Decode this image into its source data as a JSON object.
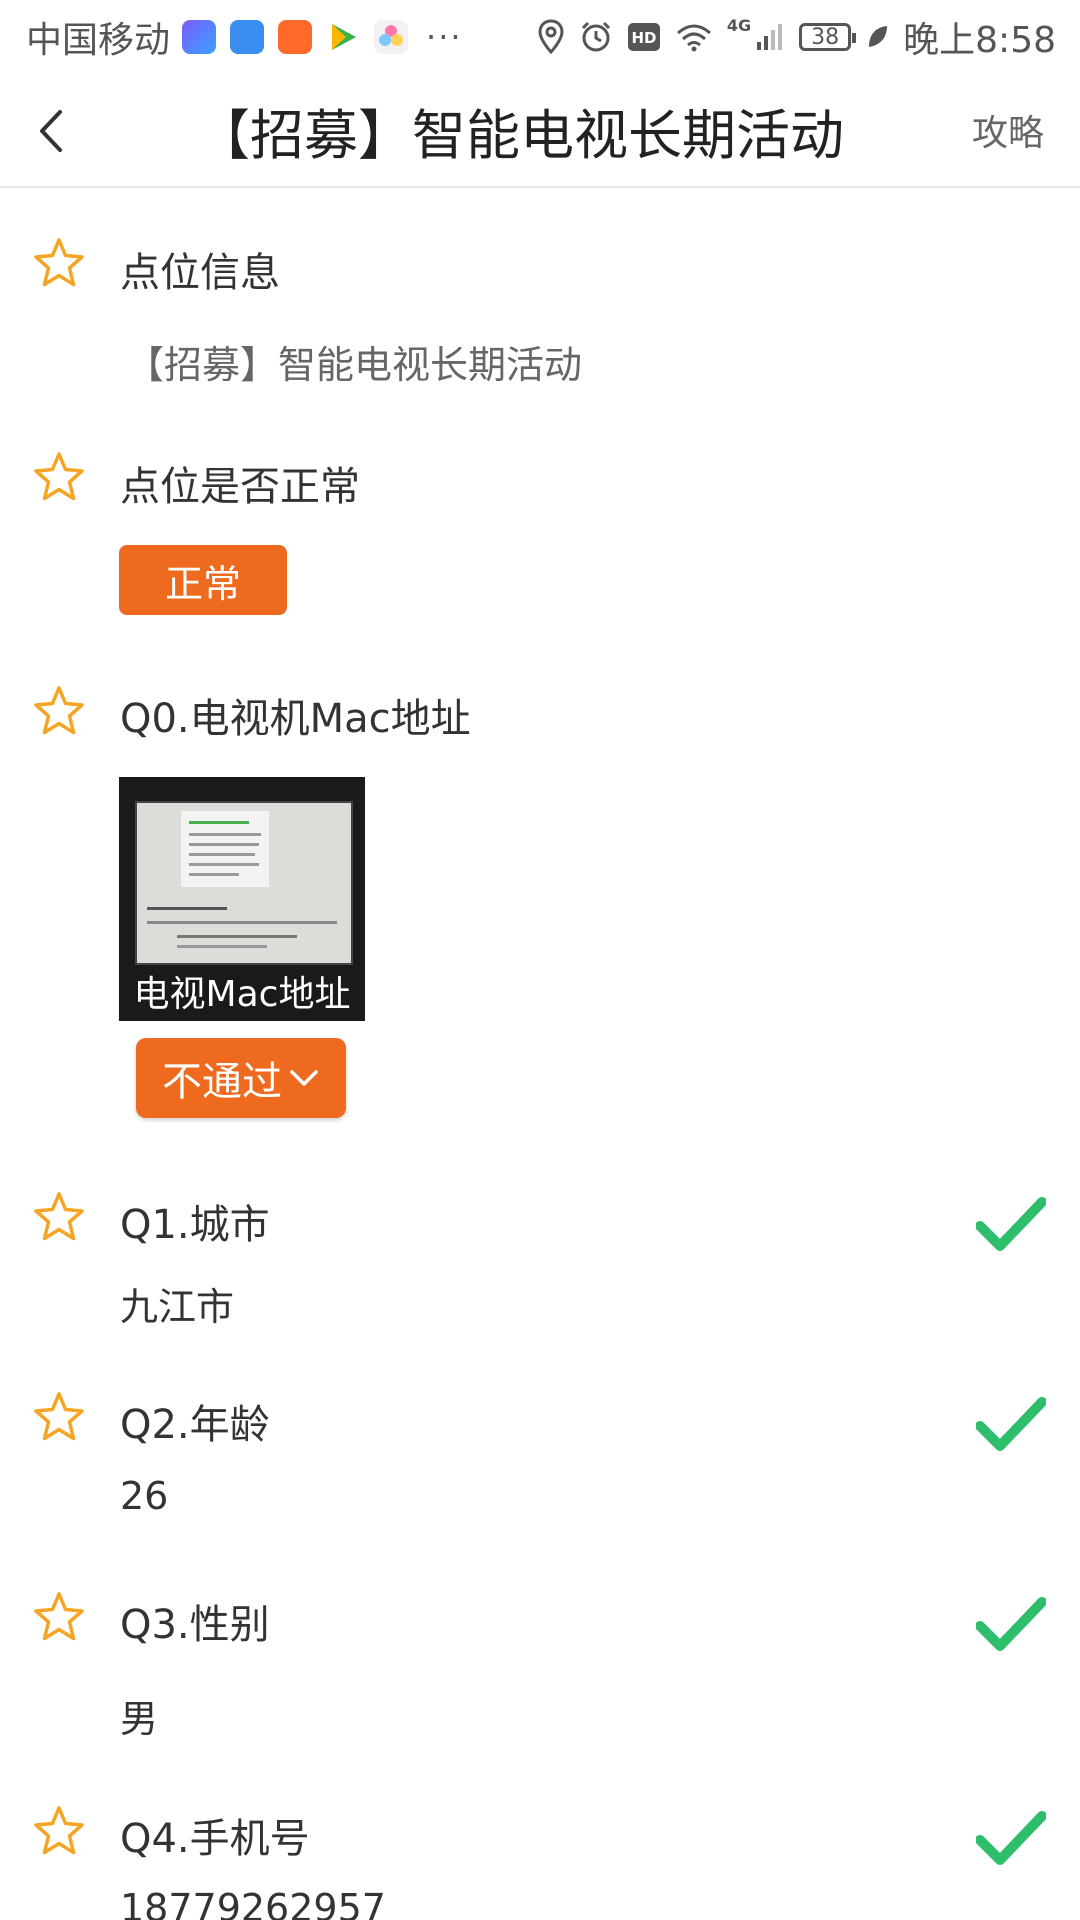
{
  "status_bar": {
    "carrier": "中国移动",
    "more": "···",
    "network": "4G",
    "battery": "38",
    "time": "晚上8:58",
    "icons": [
      "video-app-icon",
      "card-app-icon",
      "play-app-icon",
      "tencent-video-icon",
      "flower-app-icon",
      "location-icon",
      "alarm-icon",
      "hd-icon",
      "wifi-icon",
      "signal-icon",
      "battery-icon",
      "leaf-icon"
    ]
  },
  "header": {
    "title": "【招募】智能电视长期活动",
    "guide": "攻略"
  },
  "colors": {
    "accent": "#ee6a1f",
    "star": "#f5a524",
    "check": "#2ebd6b"
  },
  "questions": {
    "point_info": {
      "title": "点位信息",
      "answer": "【招募】智能电视长期活动"
    },
    "point_normal": {
      "title": "点位是否正常",
      "button": "正常"
    },
    "q0": {
      "title": "Q0.电视机Mac地址",
      "image_caption": "电视Mac地址",
      "status_button": "不通过"
    },
    "q1": {
      "title": "Q1.城市",
      "answer": "九江市"
    },
    "q2": {
      "title": "Q2.年龄",
      "answer": "26"
    },
    "q3": {
      "title": "Q3.性别",
      "answer": "男"
    },
    "q4": {
      "title": "Q4.手机号",
      "answer": "18779262957"
    }
  }
}
